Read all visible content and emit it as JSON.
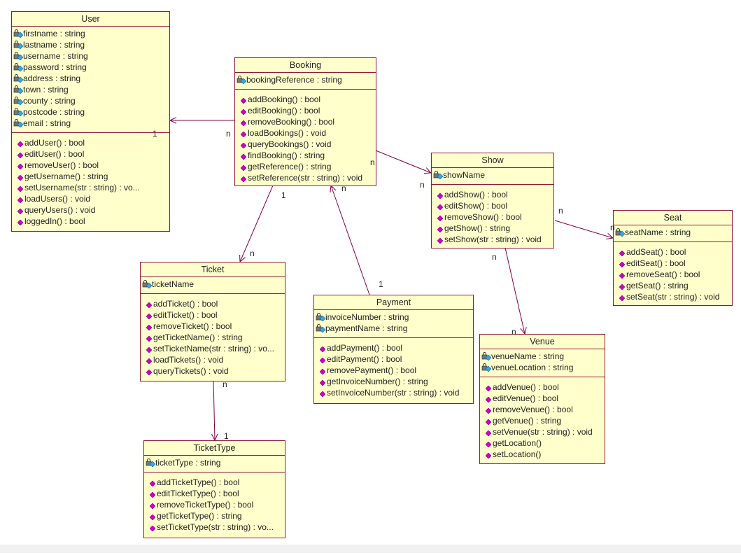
{
  "colors": {
    "fill": "#ffffcc",
    "border": "#8b1a3a",
    "line": "#800040",
    "op_icon": "#cc00cc",
    "attr_icon": "#33aadd"
  },
  "icons": {
    "attribute": "private-attribute-lock-icon",
    "operation": "public-operation-diamond-icon"
  },
  "classes": [
    {
      "id": "user",
      "name": "User",
      "attributes": [
        "firstname : string",
        "lastname : string",
        "username : string",
        "password : string",
        "address : string",
        "town : string",
        "county : string",
        "postcode : string",
        "email : string"
      ],
      "operations": [
        "addUser() : bool",
        "editUser() : bool",
        "removeUser() : bool",
        "getUsername() : string",
        "setUsername(str : string) : vo...",
        "loadUsers() : void",
        "queryUsers() : void",
        "loggedIn() : bool"
      ]
    },
    {
      "id": "booking",
      "name": "Booking",
      "attributes": [
        "bookingReference : string"
      ],
      "operations": [
        "addBooking() : bool",
        "editBooking() : bool",
        "removeBooking() : bool",
        "loadBookings() : void",
        "queryBookings() : void",
        "findBooking() : string",
        "getReference() : string",
        "setReference(str : string) : void"
      ]
    },
    {
      "id": "show",
      "name": "Show",
      "attributes": [
        "showName"
      ],
      "operations": [
        "addShow() : bool",
        "editShow() : bool",
        "removeShow() : bool",
        "getShow() : string",
        "setShow(str : string) : void"
      ]
    },
    {
      "id": "seat",
      "name": "Seat",
      "attributes": [
        "seatName : string"
      ],
      "operations": [
        "addSeat() : bool",
        "editSeat() : bool",
        "removeSeat() : bool",
        "getSeat() : string",
        "setSeat(str : string) : void"
      ]
    },
    {
      "id": "ticket",
      "name": "Ticket",
      "attributes": [
        "ticketName"
      ],
      "operations": [
        "addTicket() : bool",
        "editTicket() : bool",
        "removeTicket() : bool",
        "getTicketName() : string",
        "setTicketName(str : string) : vo...",
        "loadTickets() : void",
        "queryTickets() : void"
      ]
    },
    {
      "id": "payment",
      "name": "Payment",
      "attributes": [
        "invoiceNumber : string",
        "paymentName : string"
      ],
      "operations": [
        "addPayment() : bool",
        "editPayment() : bool",
        "removePayment() : bool",
        "getInvoiceNumber() : string",
        "setInvoiceNumber(str : string) : void"
      ]
    },
    {
      "id": "venue",
      "name": "Venue",
      "attributes": [
        "venueName : string",
        "venueLocation : string"
      ],
      "operations": [
        "addVenue() : bool",
        "editVenue() : bool",
        "removeVenue() : bool",
        "getVenue() : string",
        "setVenue(str : string) : void",
        "getLocation()",
        "setLocation()"
      ]
    },
    {
      "id": "tickettype",
      "name": "TicketType",
      "attributes": [
        "ticketType : string"
      ],
      "operations": [
        "addTicketType() : bool",
        "editTicketType() : bool",
        "removeTicketType() : bool",
        "getTicketType() : string",
        "setTicketType(str : string) : vo..."
      ]
    }
  ],
  "associations": [
    {
      "from": "Booking",
      "to": "User",
      "from_mult": "n",
      "to_mult": "1"
    },
    {
      "from": "Booking",
      "to": "Show",
      "from_mult": "n",
      "to_mult": "n"
    },
    {
      "from": "Booking",
      "to": "Ticket",
      "from_mult": "1",
      "to_mult": "n"
    },
    {
      "from": "Payment",
      "to": "Booking",
      "from_mult": "1",
      "to_mult": "n"
    },
    {
      "from": "Show",
      "to": "Seat",
      "from_mult": "n",
      "to_mult": "n"
    },
    {
      "from": "Show",
      "to": "Venue",
      "from_mult": "n",
      "to_mult": "n"
    },
    {
      "from": "Ticket",
      "to": "TicketType",
      "from_mult": "n",
      "to_mult": "1"
    }
  ]
}
